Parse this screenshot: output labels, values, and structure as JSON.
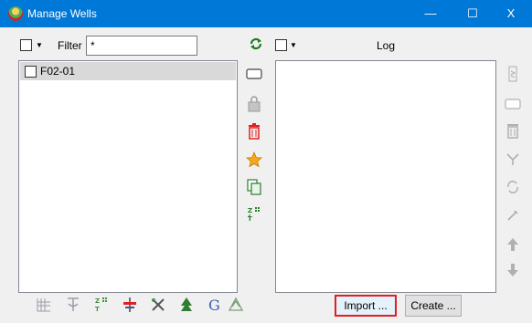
{
  "window": {
    "title": "Manage Wells",
    "minimize": "—",
    "maximize": "☐",
    "close": "X"
  },
  "wells": {
    "filter_label": "Filter",
    "filter_value": "*",
    "items": [
      {
        "name": "F02-01",
        "checked": false
      }
    ]
  },
  "log": {
    "header": "Log",
    "items": []
  },
  "buttons": {
    "import": "Import ...",
    "create": "Create ..."
  },
  "icons": {
    "refresh": "refresh-icon",
    "well_mid": [
      "rename-icon",
      "lock-icon",
      "delete-icon",
      "star-icon",
      "copy-icon",
      "sort-icon"
    ],
    "log_side": [
      "export-icon",
      "rename-icon",
      "delete-icon",
      "merge-icon",
      "resample-icon",
      "calculate-icon",
      "move-up-icon",
      "move-down-icon"
    ],
    "bottom": [
      "well-track-icon",
      "depth-time-icon",
      "tie-icon",
      "marker-icon",
      "tool-icon",
      "tree-icon",
      "g-icon",
      "simple-icon"
    ]
  },
  "colors": {
    "titlebar": "#0078d7",
    "selected_item": "#d9d9d9",
    "focus_border": "#e02020",
    "delete_red": "#e02020",
    "refresh_green": "#1f7a1f",
    "star_orange": "#f4a81d"
  }
}
